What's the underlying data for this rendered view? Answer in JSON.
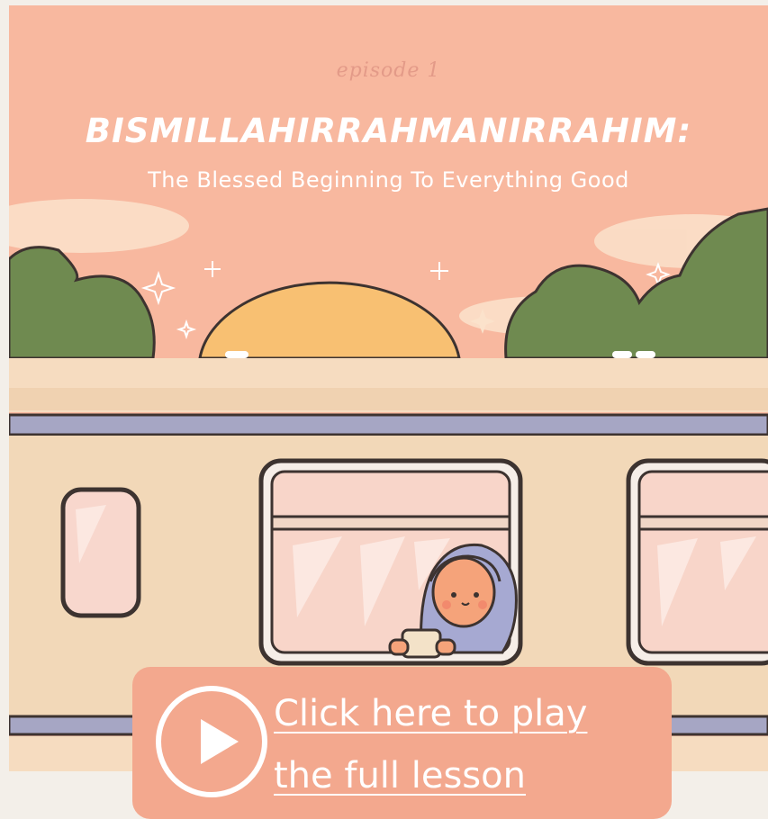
{
  "episode": {
    "label": "episode 1",
    "title": "BISMILLAHIRRAHMANIRRAHIM:",
    "subtitle": "The Blessed Beginning To Everything Good"
  },
  "cta": {
    "line1": "Click here to play",
    "line2": "the full lesson"
  },
  "colors": {
    "sky": "#f8b89f",
    "cta_background": "#f3a88e",
    "page_background": "#f3efe9",
    "train": "#f2d8b8",
    "sun": "#f8c072",
    "trees": "#6f8a50",
    "hijab": "#a6a9d2"
  },
  "icons": {
    "play": "play-circle-icon"
  }
}
